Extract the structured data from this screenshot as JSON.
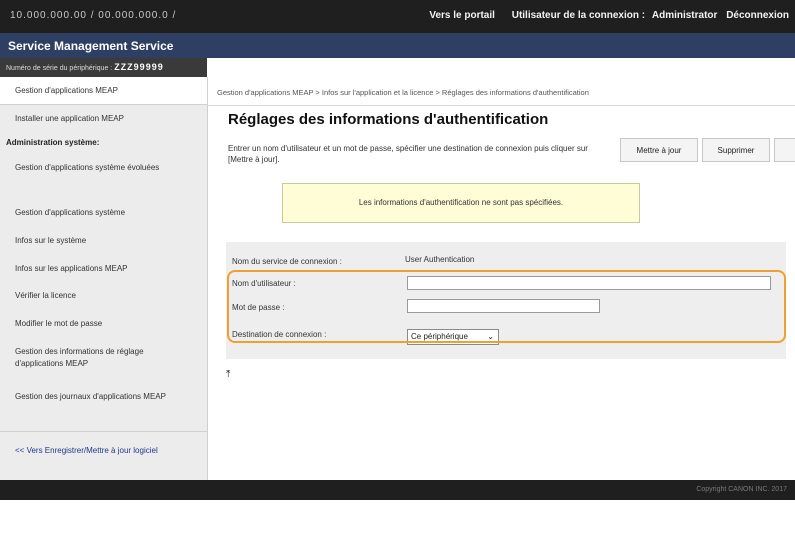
{
  "topbar": {
    "ip": "10.000.000.00 / 00.000.000.0 /",
    "portal_link": "Vers le portail",
    "login_user_label": "Utilisateur de la connexion :",
    "login_user_name": "Administrator",
    "logout_link": "Déconnexion"
  },
  "app_title": "Service Management Service",
  "serial": {
    "label": "Numéro de série du périphérique :",
    "value": "ZZZ99999"
  },
  "sidebar": {
    "items": [
      {
        "label": "Gestion d'applications MEAP"
      },
      {
        "label": "Installer une application MEAP"
      }
    ],
    "section_title": "Administration système:",
    "admin_items": [
      {
        "label": "Gestion d'applications système évoluées"
      },
      {
        "label": "Gestion d'applications système"
      },
      {
        "label": "Infos sur le système"
      },
      {
        "label": "Infos sur les applications MEAP"
      },
      {
        "label": "Vérifier la licence"
      },
      {
        "label": "Modifier le mot de passe"
      },
      {
        "label": "Gestion des informations de réglage d'applications MEAP"
      },
      {
        "label": "Gestion des journaux d'applications MEAP"
      }
    ],
    "bottom_link": "<< Vers Enregistrer/Mettre à jour logiciel"
  },
  "main": {
    "breadcrumb": "Gestion d'applications MEAP > Infos sur l'application et la licence > Réglages des informations d'authentification",
    "title": "Réglages des informations d'authentification",
    "description": "Entrer un nom d'utilisateur et un mot de passe, spécifier une destination de connexion puis cliquer sur [Mettre à jour].",
    "update_button": "Mettre à jour",
    "delete_button": "Supprimer",
    "notice": "Les informations d'authentification ne sont pas spécifiées.",
    "form": {
      "service_label": "Nom du service de connexion :",
      "service_value": "User Authentication",
      "username_label": "Nom d'utilisateur :",
      "username_value": "",
      "password_label": "Mot de passe :",
      "password_value": "",
      "destination_label": "Destination de connexion :",
      "destination_value": "Ce périphérique"
    },
    "to_top_icon": "arrow-up-to-top-icon"
  },
  "footer": {
    "copyright": "Copyright CANON INC. 2017"
  }
}
